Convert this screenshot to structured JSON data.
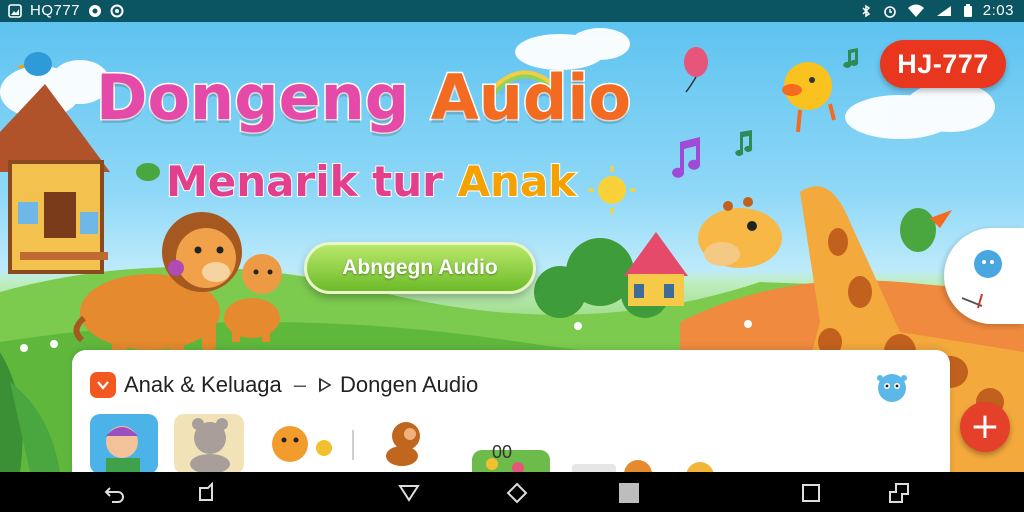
{
  "status_bar": {
    "left_text": "HQ777",
    "right_text": "2:03"
  },
  "hero": {
    "title_word1": "Dongeng",
    "title_word2": "Audio",
    "subtitle_word1": "Menarik tur",
    "subtitle_word2": "Anak",
    "cta_label": "Abngegn Audio",
    "brand_badge": "HJ-777"
  },
  "card": {
    "category": "Anak & Keluaga",
    "separator": "–",
    "section": "Dongen Audio",
    "counter": "00"
  },
  "fab_label": "+",
  "colors": {
    "status_bar": "#0b5563",
    "brand_red": "#e8361f",
    "cta_green": "#6dbb2a",
    "fab_red": "#e5402a"
  },
  "icons": [
    "gallery-icon",
    "mail-icon",
    "circle-icon",
    "bluetooth-icon",
    "alarm-icon",
    "wifi-icon",
    "signal-icon",
    "battery-icon",
    "back-icon",
    "recent-square-icon",
    "home-triangle-icon",
    "diamond-icon",
    "square-icon",
    "overview-icon",
    "rotate-icon",
    "plus-icon"
  ]
}
